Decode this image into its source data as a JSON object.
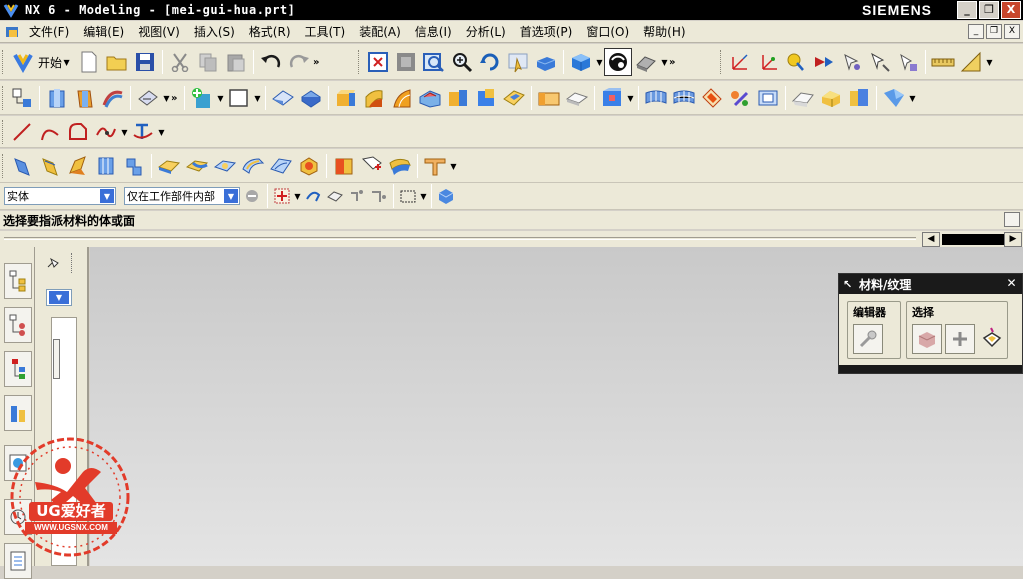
{
  "window": {
    "title": "NX 6 - Modeling - [mei-gui-hua.prt]",
    "brand": "SIEMENS",
    "controls": [
      "_",
      "❐",
      "X"
    ]
  },
  "menu": {
    "items": [
      "文件(F)",
      "编辑(E)",
      "视图(V)",
      "插入(S)",
      "格式(R)",
      "工具(T)",
      "装配(A)",
      "信息(I)",
      "分析(L)",
      "首选项(P)",
      "窗口(O)",
      "帮助(H)"
    ]
  },
  "toolbar": {
    "start_label": "开始",
    "standard_icons": [
      "new-icon",
      "open-icon",
      "save-icon",
      "cut-icon",
      "copy-icon",
      "paste-icon",
      "undo-icon",
      "redo-icon"
    ],
    "view_icons": [
      "fit-icon",
      "zoom-window-icon",
      "zoom-icon",
      "magnify-icon",
      "rotate-icon",
      "pan-icon",
      "perspective-icon",
      "shaded-icon",
      "edge-display-icon",
      "shading-style-icon"
    ],
    "utility_icons": [
      "wcs-icon",
      "wcs-orient-icon",
      "layer-icon",
      "measure-icon",
      "select-icon",
      "color-icon",
      "distance-icon",
      "analysis-icon"
    ],
    "feature_icons": [
      "part-navigator-icon",
      "extrude-icon",
      "revolve-icon",
      "sweep-icon",
      "datum-icon",
      "point-icon",
      "sketch-icon",
      "block-icon",
      "cylinder-icon",
      "cone-icon",
      "sphere-icon",
      "hole-icon",
      "boss-icon",
      "pocket-icon",
      "pad-icon",
      "slot-icon",
      "groove-icon",
      "thread-icon",
      "mesh-icon",
      "surface-icon",
      "through-curves-icon",
      "sewing-icon",
      "trim-icon",
      "offset-face-icon",
      "draft-icon",
      "shell-icon",
      "extract-icon"
    ],
    "curve_icons": [
      "line-icon",
      "arc-icon",
      "fillet-curve-icon",
      "spline-icon",
      "text-icon"
    ],
    "surface_icons": [
      "four-point-icon",
      "ruled-icon",
      "through-curve-mesh-icon",
      "n-sided-icon",
      "studio-surface-icon",
      "edge-blend-icon",
      "face-blend-icon",
      "chamfer-icon",
      "blend-corner-icon",
      "soft-blend-icon",
      "material-icon",
      "texture-icon",
      "decal-icon",
      "tube-icon"
    ]
  },
  "filter": {
    "type_value": "实体",
    "scope_value": "仅在工作部件内部"
  },
  "cue_line": "选择要指派材料的体或面",
  "dialog": {
    "title": "材料/纹理",
    "editor_label": "编辑器",
    "select_label": "选择"
  },
  "watermark": {
    "brand": "UG爱好者",
    "url": "WWW.UGSNX.COM"
  },
  "colors": {
    "titlebar": "#000000",
    "menubar": "#ece9d8",
    "graphics_top": "#c9c9c9",
    "graphics_bottom": "#e4e4e4",
    "watermark_red": "#e23b2a"
  }
}
